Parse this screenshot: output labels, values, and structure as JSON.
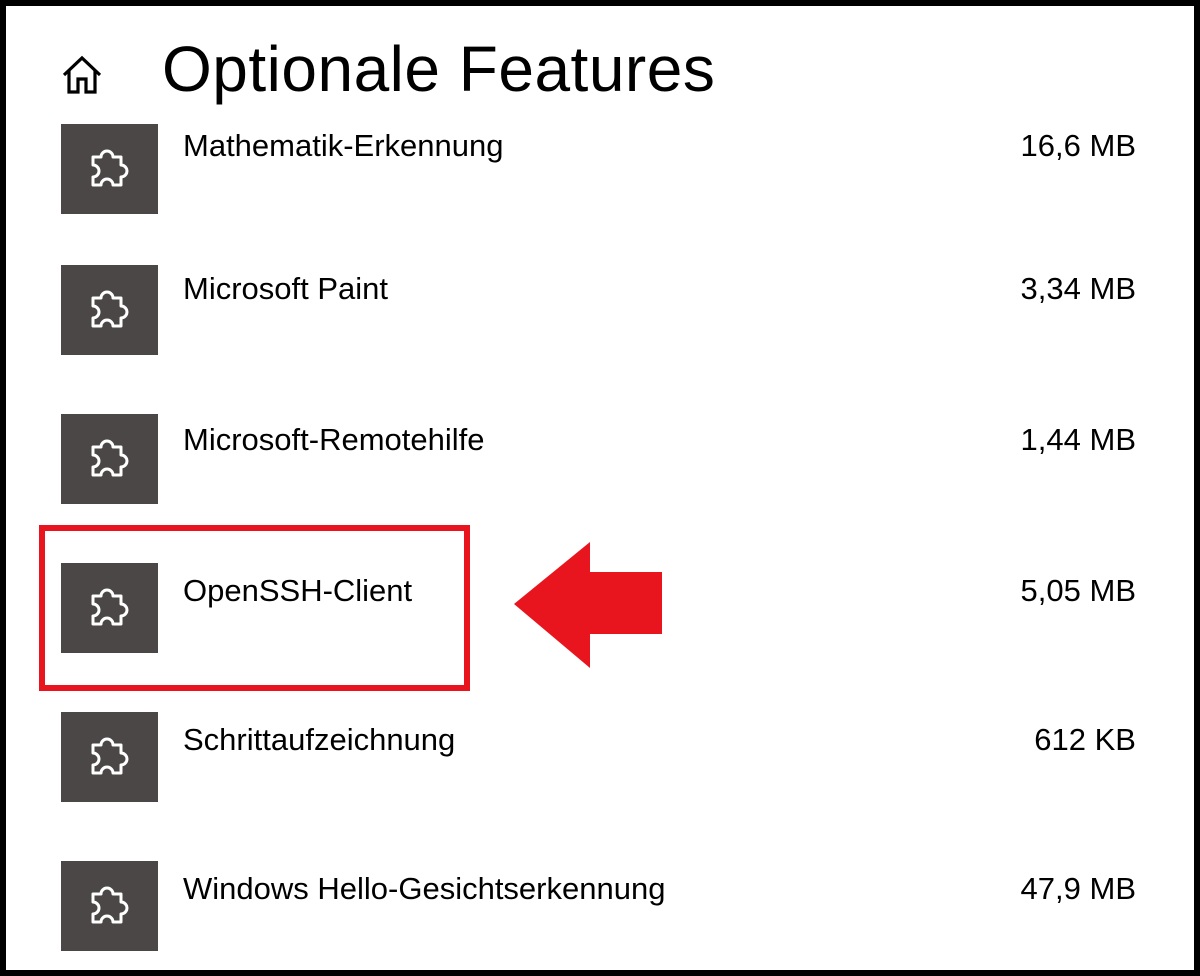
{
  "header": {
    "title": "Optionale Features",
    "home_icon": "home-icon"
  },
  "features": [
    {
      "name": "Mathematik-Erkennung",
      "size": "16,6 MB",
      "icon": "puzzle-icon"
    },
    {
      "name": "Microsoft Paint",
      "size": "3,34 MB",
      "icon": "puzzle-icon"
    },
    {
      "name": "Microsoft-Remotehilfe",
      "size": "1,44 MB",
      "icon": "puzzle-icon"
    },
    {
      "name": "OpenSSH-Client",
      "size": "5,05 MB",
      "icon": "puzzle-icon",
      "highlighted": true
    },
    {
      "name": "Schrittaufzeichnung",
      "size": "612 KB",
      "icon": "puzzle-icon"
    },
    {
      "name": "Windows Hello-Gesichtserkennung",
      "size": "47,9 MB",
      "icon": "puzzle-icon"
    }
  ],
  "colors": {
    "tile": "#4a4746",
    "annotation": "#e8151f",
    "background": "#ffffff"
  }
}
